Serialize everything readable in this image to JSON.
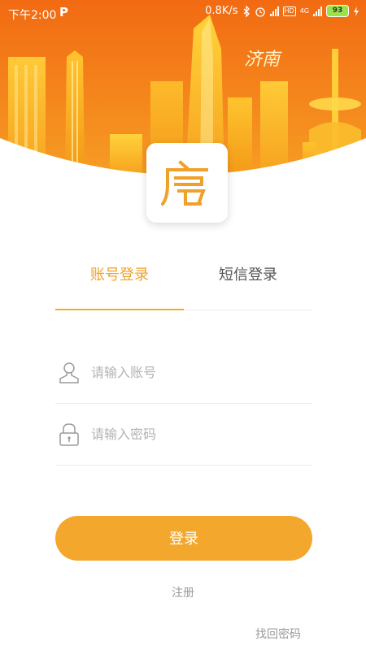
{
  "status_bar": {
    "time": "下午2:00",
    "app_indicator": "P",
    "network_speed": "0.8K/s",
    "hd_label": "HD",
    "network_type": "4G",
    "battery_level": "93"
  },
  "banner": {
    "city_text": "济南"
  },
  "logo": {
    "glyph": "房"
  },
  "tabs": [
    {
      "label": "账号登录",
      "active": true
    },
    {
      "label": "短信登录",
      "active": false
    }
  ],
  "form": {
    "account_placeholder": "请输入账号",
    "account_value": "",
    "password_placeholder": "请输入密码",
    "password_value": ""
  },
  "actions": {
    "login_label": "登录",
    "register_label": "注册",
    "forgot_label": "找回密码"
  },
  "colors": {
    "accent": "#f3a72c",
    "banner_top": "#f26a12",
    "banner_bottom": "#f6a025",
    "placeholder": "#b3b3b3"
  }
}
